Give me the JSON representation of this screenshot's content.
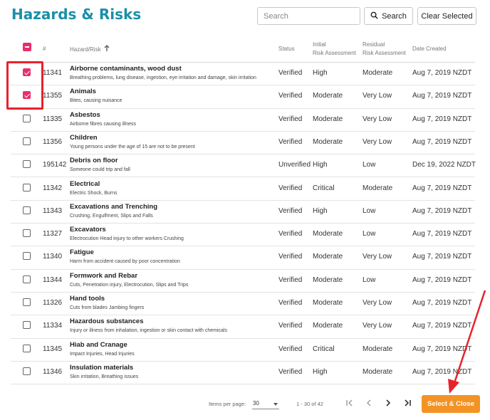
{
  "title": "Hazards & Risks",
  "search": {
    "placeholder": "Search",
    "button_label": "Search"
  },
  "clear_label": "Clear Selected",
  "columns": {
    "id": "#",
    "name": "Hazard/Risk",
    "status": "Status",
    "initial_1": "Initial",
    "initial_2": "Risk Assessment",
    "residual_1": "Residual",
    "residual_2": "Risk Assessment",
    "date": "Date Created"
  },
  "rows": [
    {
      "checked": true,
      "id": "11341",
      "name": "Airborne contaminants, wood dust",
      "desc": "Breathing problems, lung disease, ingestion, eye irritation and damage, skin irritation",
      "status": "Verified",
      "initial": "High",
      "residual": "Moderate",
      "date": "Aug 7, 2019 NZDT"
    },
    {
      "checked": true,
      "id": "11355",
      "name": "Animals",
      "desc": "Bites, causing nuisance",
      "status": "Verified",
      "initial": "Moderate",
      "residual": "Very Low",
      "date": "Aug 7, 2019 NZDT"
    },
    {
      "checked": false,
      "id": "11335",
      "name": "Asbestos",
      "desc": "Airborne fibres causing illness",
      "status": "Verified",
      "initial": "Moderate",
      "residual": "Very Low",
      "date": "Aug 7, 2019 NZDT"
    },
    {
      "checked": false,
      "id": "11356",
      "name": "Children",
      "desc": "Young persons under the age of 15 are not to be present",
      "status": "Verified",
      "initial": "Moderate",
      "residual": "Very Low",
      "date": "Aug 7, 2019 NZDT"
    },
    {
      "checked": false,
      "id": "195142",
      "name": "Debris on floor",
      "desc": "Someone could trip and fall",
      "status": "Unverified",
      "initial": "High",
      "residual": "Low",
      "date": "Dec 19, 2022 NZDT"
    },
    {
      "checked": false,
      "id": "11342",
      "name": "Electrical",
      "desc": "Electric Shock, Burns",
      "status": "Verified",
      "initial": "Critical",
      "residual": "Moderate",
      "date": "Aug 7, 2019 NZDT"
    },
    {
      "checked": false,
      "id": "11343",
      "name": "Excavations and Trenching",
      "desc": "Crushing, Engulfment, Slips and Falls",
      "status": "Verified",
      "initial": "High",
      "residual": "Low",
      "date": "Aug 7, 2019 NZDT"
    },
    {
      "checked": false,
      "id": "11327",
      "name": "Excavators",
      "desc": "Electrocution Head injury to other workers Crushing",
      "status": "Verified",
      "initial": "Moderate",
      "residual": "Low",
      "date": "Aug 7, 2019 NZDT"
    },
    {
      "checked": false,
      "id": "11340",
      "name": "Fatigue",
      "desc": "Harm from accident caused by poor concentration",
      "status": "Verified",
      "initial": "Moderate",
      "residual": "Very Low",
      "date": "Aug 7, 2019 NZDT"
    },
    {
      "checked": false,
      "id": "11344",
      "name": "Formwork and Rebar",
      "desc": "Cuts, Penetration injury, Electrocution, Slips and Trips",
      "status": "Verified",
      "initial": "Moderate",
      "residual": "Low",
      "date": "Aug 7, 2019 NZDT"
    },
    {
      "checked": false,
      "id": "11326",
      "name": "Hand tools",
      "desc": "Cuts from blades Jambing fingers",
      "status": "Verified",
      "initial": "Moderate",
      "residual": "Very Low",
      "date": "Aug 7, 2019 NZDT"
    },
    {
      "checked": false,
      "id": "11334",
      "name": "Hazardous substances",
      "desc": "Injury or illness from inhalation, ingestion or skin contact with chemicals",
      "status": "Verified",
      "initial": "Moderate",
      "residual": "Very Low",
      "date": "Aug 7, 2019 NZDT"
    },
    {
      "checked": false,
      "id": "11345",
      "name": "Hiab and Cranage",
      "desc": "Impact Injuries, Head Injuries",
      "status": "Verified",
      "initial": "Critical",
      "residual": "Moderate",
      "date": "Aug 7, 2019 NZDT"
    },
    {
      "checked": false,
      "id": "11346",
      "name": "Insulation materials",
      "desc": "Skin irritation, Breathing issues",
      "status": "Verified",
      "initial": "High",
      "residual": "Moderate",
      "date": "Aug 7, 2019 NZDT"
    }
  ],
  "footer": {
    "items_per_page_label": "Items per page:",
    "items_per_page_value": "30",
    "range_text": "1 - 30 of 42",
    "select_close_label": "Select & Close"
  },
  "colors": {
    "title": "#1a8fa8",
    "accent_checkbox": "#e8306a",
    "primary_button": "#f39325",
    "annotation": "#e8222a"
  },
  "icons": [
    "search-icon",
    "sort-arrow-up-icon",
    "first-page-icon",
    "prev-page-icon",
    "next-page-icon",
    "last-page-icon",
    "dropdown-arrow-icon"
  ]
}
